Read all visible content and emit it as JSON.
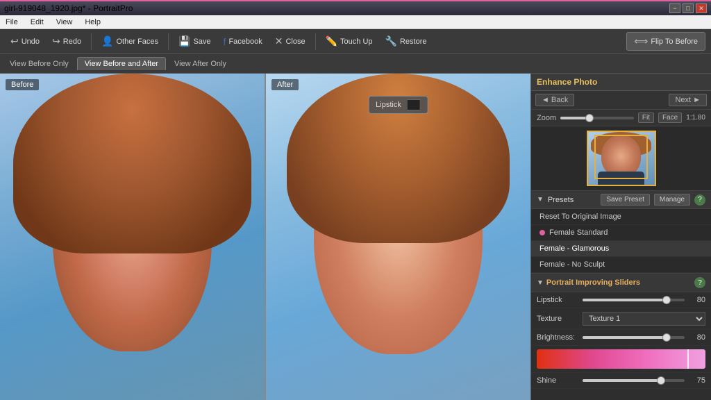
{
  "titlebar": {
    "title": "girl-919048_1920.jpg* - PortraitPro",
    "min": "−",
    "max": "□",
    "close": "✕"
  },
  "menubar": {
    "items": [
      "File",
      "Edit",
      "View",
      "Help"
    ]
  },
  "toolbar": {
    "undo": "Undo",
    "redo": "Redo",
    "other_faces": "Other Faces",
    "save": "Save",
    "facebook": "Facebook",
    "close": "Close",
    "touch_up": "Touch Up",
    "restore": "Restore",
    "flip_to_before": "Flip To Before"
  },
  "view_tabs": {
    "before_only": "View Before Only",
    "before_and_after": "View Before and After",
    "after_only": "View After Only"
  },
  "panels": {
    "before_label": "Before",
    "after_label": "After",
    "lipstick_tooltip": "Lipstick"
  },
  "right_panel": {
    "header": "Enhance Photo",
    "back": "◄ Back",
    "next": "Next ►",
    "zoom_label": "Zoom",
    "fit": "Fit",
    "face": "Face",
    "zoom_ratio": "1:1.80",
    "presets_label": "Presets",
    "save_preset": "Save Preset",
    "manage": "Manage",
    "preset_items": [
      "Reset To Original Image",
      "♀ Female Standard",
      "Female - Glamorous",
      "Female - No Sculpt"
    ],
    "sliders_title": "Portrait Improving Sliders",
    "sliders": [
      {
        "label": "Lipstick",
        "value": 80,
        "percent": 80
      },
      {
        "label": "Brightness:",
        "value": 80,
        "percent": 80
      },
      {
        "label": "Shine",
        "value": 75,
        "percent": 75
      }
    ],
    "texture_label": "Texture",
    "texture_value": "Texture 1"
  }
}
